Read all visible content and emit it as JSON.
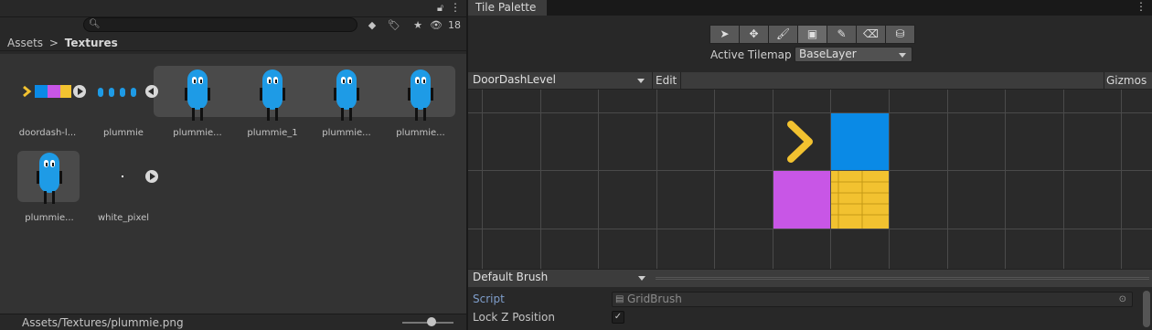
{
  "project": {
    "hidden_count": "18",
    "breadcrumb": {
      "root": "Assets",
      "separator": ">",
      "current": "Textures"
    },
    "assets": [
      {
        "label": "doordash-l..."
      },
      {
        "label": "plummie"
      },
      {
        "label": "plummie..."
      },
      {
        "label": "plummie_1"
      },
      {
        "label": "plummie..."
      },
      {
        "label": "plummie..."
      },
      {
        "label": "plummie..."
      },
      {
        "label": "white_pixel"
      }
    ],
    "status_path": "Assets/Textures/plummie.png"
  },
  "tile_palette": {
    "tab_title": "Tile Palette",
    "tools": [
      "select-arrow-icon",
      "move-icon",
      "paint-brush-icon",
      "box-fill-icon",
      "picker-icon",
      "eraser-icon",
      "fill-bucket-icon"
    ],
    "active_tilemap_label": "Active Tilemap",
    "active_tilemap_value": "BaseLayer",
    "palette_name": "DoorDashLevel",
    "edit_label": "Edit",
    "gizmos_label": "Gizmos",
    "brush_name": "Default Brush",
    "inspector": {
      "script_label": "Script",
      "script_value": "GridBrush",
      "lock_z_label": "Lock Z Position",
      "lock_z_checked": "✓"
    }
  },
  "colors": {
    "accent_blue": "#0a8ae6",
    "tile_purple": "#c856e6",
    "tile_yellow": "#f2c230",
    "mascot_blue": "#1e9be6"
  }
}
